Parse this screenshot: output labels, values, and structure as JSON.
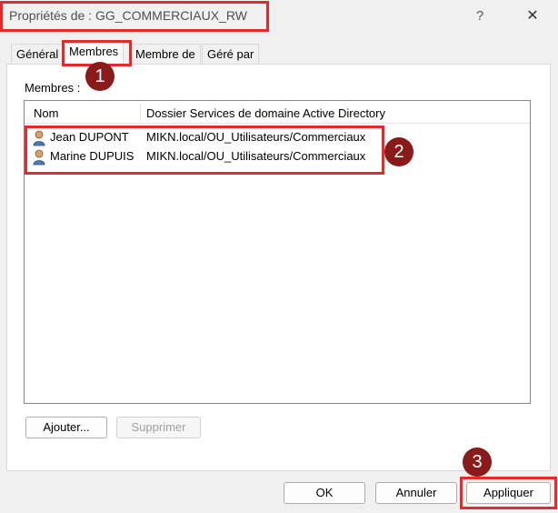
{
  "window": {
    "title": "Propriétés de : GG_COMMERCIAUX_RW",
    "help_glyph": "?",
    "close_glyph": "✕"
  },
  "tabs": [
    {
      "label": "Général"
    },
    {
      "label": "Membres"
    },
    {
      "label": "Membre de"
    },
    {
      "label": "Géré par"
    }
  ],
  "members": {
    "label": "Membres :",
    "columns": [
      "Nom",
      "Dossier Services de domaine Active Directory"
    ],
    "rows": [
      {
        "name": "Jean DUPONT",
        "folder": "MIKN.local/OU_Utilisateurs/Commerciaux",
        "icon": "user-icon"
      },
      {
        "name": "Marine DUPUIS",
        "folder": "MIKN.local/OU_Utilisateurs/Commerciaux",
        "icon": "user-icon"
      }
    ],
    "add_label": "Ajouter...",
    "remove_label": "Supprimer"
  },
  "footer": {
    "ok_label": "OK",
    "cancel_label": "Annuler",
    "apply_label": "Appliquer"
  },
  "annotations": {
    "color": "#e32b2b",
    "badge_color": "#8b1a1a",
    "badges": [
      "1",
      "2",
      "3"
    ]
  }
}
